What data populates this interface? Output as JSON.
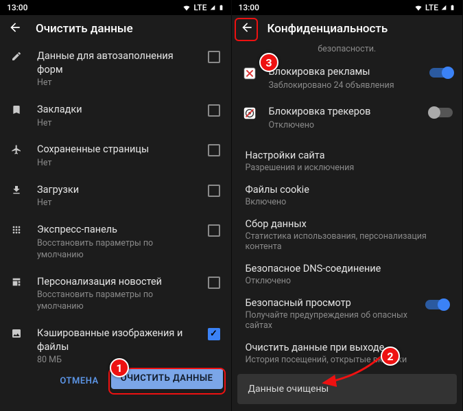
{
  "status": {
    "time": "13:00",
    "network": "LTE"
  },
  "left": {
    "title": "Очистить данные",
    "items": [
      {
        "icon": "pencil",
        "title": "Данные для автозаполнения форм",
        "sub": "Нет",
        "checked": false
      },
      {
        "icon": "bookmark",
        "title": "Закладки",
        "sub": "Нет",
        "checked": false
      },
      {
        "icon": "plane",
        "title": "Сохраненные страницы",
        "sub": "Нет",
        "checked": false
      },
      {
        "icon": "download",
        "title": "Загрузки",
        "sub": "Нет",
        "checked": false
      },
      {
        "icon": "grid",
        "title": "Экспресс-панель",
        "sub": "Восстановить параметры по умолчанию",
        "checked": false
      },
      {
        "icon": "news",
        "title": "Персонализация новостей",
        "sub": "Восстановить параметры по умолчанию",
        "checked": false
      },
      {
        "icon": "image",
        "title": "Кэшированные изображения и файлы",
        "sub": "80 МБ",
        "checked": true
      }
    ],
    "cancel": "ОТМЕНА",
    "confirm": "ОЧИСТИТЬ ДАННЫЕ"
  },
  "right": {
    "title": "Конфиденциальность",
    "top_sub": "безопасности.",
    "toggles": [
      {
        "title": "Блокировка рекламы",
        "sub": "Заблокировано 24 объявления",
        "on": true,
        "icon": "adblock"
      },
      {
        "title": "Блокировка трекеров",
        "sub": "Отключено",
        "on": false,
        "icon": "trackblock"
      }
    ],
    "rows": [
      {
        "title": "Настройки сайта",
        "sub": "Разрешения и исключения"
      },
      {
        "title": "Файлы cookie",
        "sub": "Включено"
      },
      {
        "title": "Сбор данных",
        "sub": "Статистика использования, персонализация контента"
      },
      {
        "title": "Безопасное DNS-соединение",
        "sub": "Отключено"
      }
    ],
    "secure_browse": {
      "title": "Безопасный просмотр",
      "sub": "Получайте предупреждения об опасных сайтах",
      "on": true
    },
    "clear_exit": {
      "title": "Очистить данные при выходе",
      "sub": "История посещений, открытые вкладки"
    },
    "toast": "Данные очищены"
  },
  "badges": {
    "b1": "1",
    "b2": "2",
    "b3": "3"
  }
}
